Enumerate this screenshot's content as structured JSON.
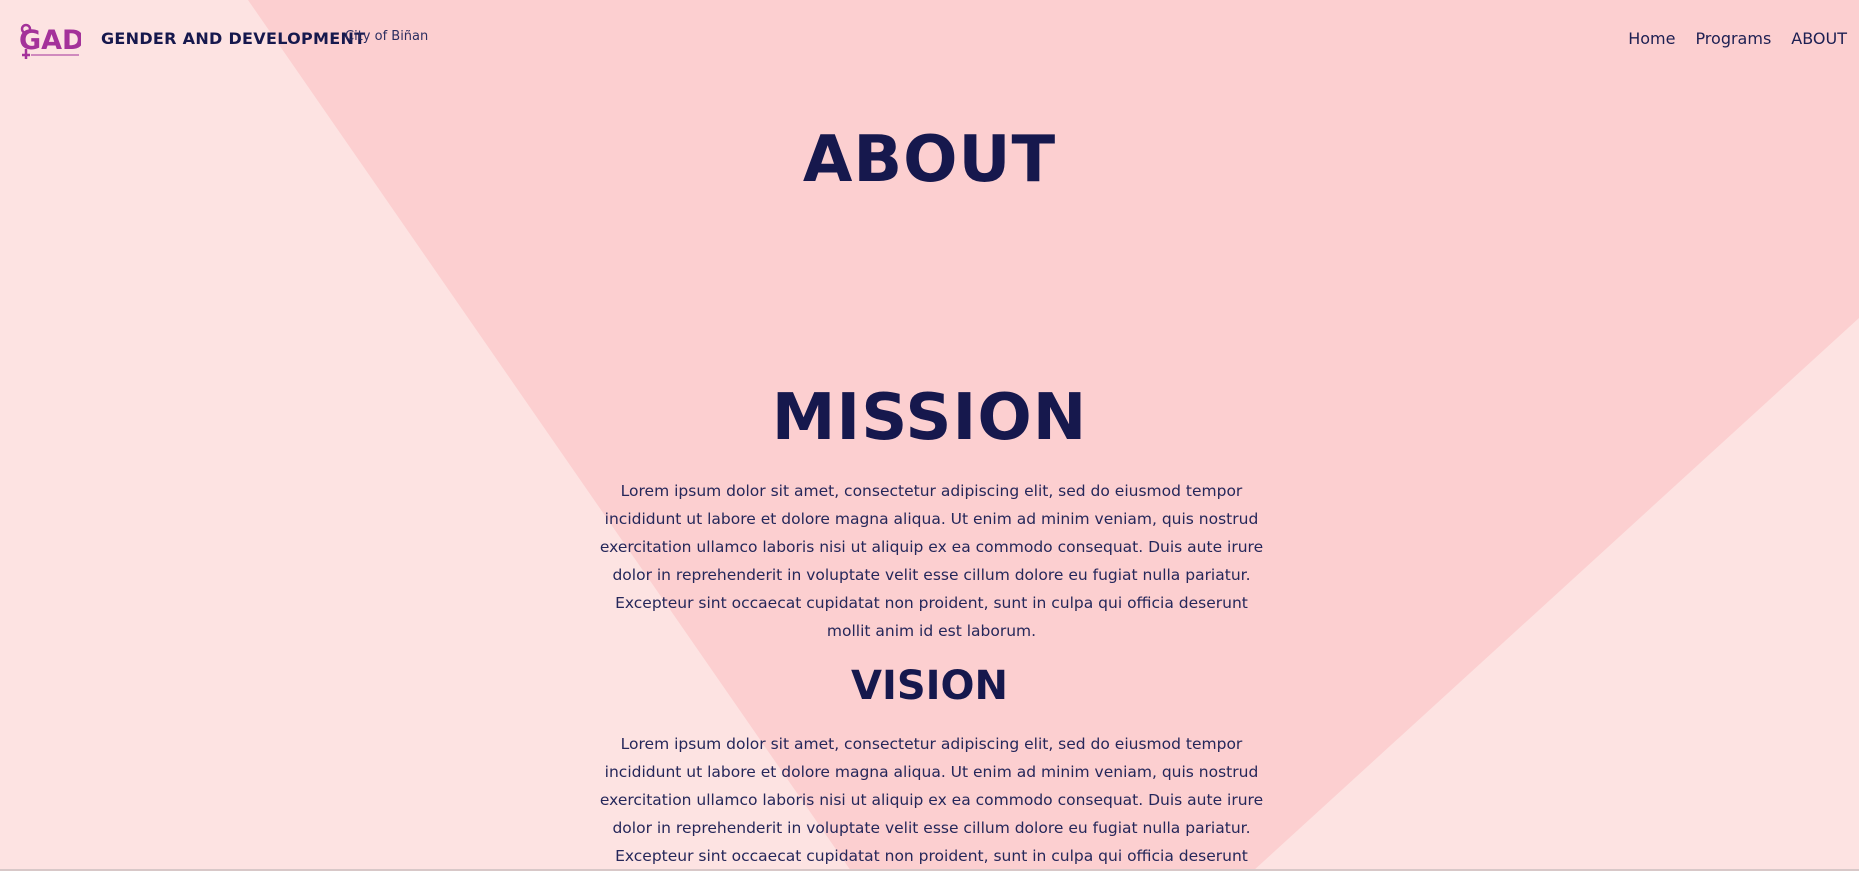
{
  "header": {
    "logo_text": "GAD",
    "title": "GENDER AND DEVELOPMENT",
    "subtitle": "City of Biñan",
    "nav": [
      "Home",
      "Programs",
      "ABOUT"
    ]
  },
  "main": {
    "about_title": "ABOUT",
    "mission_title": "MISSION",
    "mission_text": "Lorem ipsum dolor sit amet, consectetur adipiscing elit, sed do eiusmod tempor incididunt ut labore et dolore magna aliqua. Ut enim ad minim veniam, quis nostrud exercitation ullamco laboris nisi ut aliquip ex ea commodo consequat. Duis aute irure dolor in reprehenderit in voluptate velit esse cillum dolore eu fugiat nulla pariatur. Excepteur sint occaecat cupidatat non proident, sunt in culpa qui officia deserunt mollit anim id est laborum.",
    "vision_title": "VISION",
    "vision_text": "Lorem ipsum dolor sit amet, consectetur adipiscing elit, sed do eiusmod tempor incididunt ut labore et dolore magna aliqua. Ut enim ad minim veniam, quis nostrud exercitation ullamco laboris nisi ut aliquip ex ea commodo consequat. Duis aute irure dolor in reprehenderit in voluptate velit esse cillum dolore eu fugiat nulla pariatur. Excepteur sint occaecat cupidatat non proident, sunt in culpa qui officia deserunt mollit"
  },
  "colors": {
    "background": "#fde3e2",
    "shape": "#fccfd0",
    "text": "#16184d",
    "logo": "#a4329a"
  }
}
